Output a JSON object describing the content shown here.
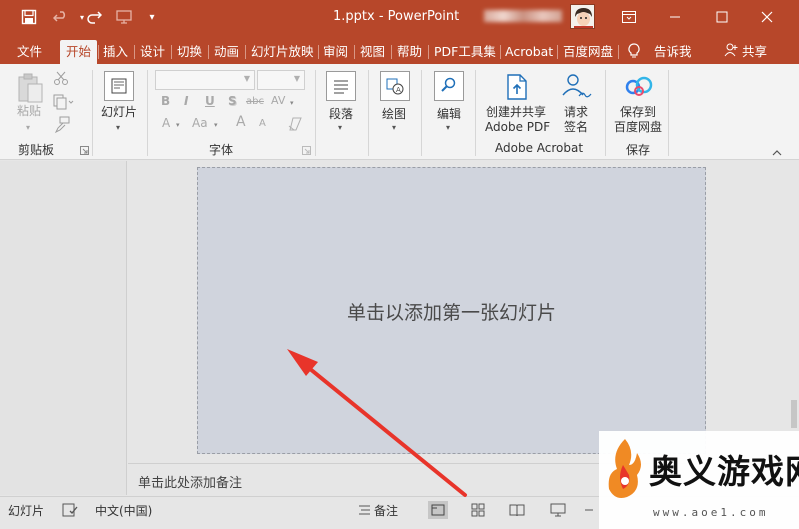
{
  "titlebar": {
    "title": "1.pptx  -  PowerPoint",
    "icons": [
      "save-icon",
      "undo-icon",
      "redo-icon",
      "start-from-beginning-icon",
      "customize-qat-icon"
    ],
    "window_buttons": [
      "ribbon-display-options-icon",
      "minimize-icon",
      "maximize-icon",
      "close-icon"
    ],
    "bg_color": "#b7472a"
  },
  "tabs": {
    "items": [
      "文件",
      "开始",
      "插入",
      "设计",
      "切换",
      "动画",
      "幻灯片放映",
      "审阅",
      "视图",
      "帮助",
      "PDF工具集",
      "Acrobat",
      "百度网盘"
    ],
    "active": "开始",
    "tell_me": "告诉我",
    "share": "共享"
  },
  "ribbon": {
    "clipboard": {
      "paste": "粘贴",
      "label": "剪贴板"
    },
    "slides": {
      "slide": "幻灯片"
    },
    "font": {
      "label": "字体",
      "bold": "B",
      "italic": "I",
      "underline": "U",
      "shadow": "S",
      "strike": "abc",
      "spacing": "AV",
      "font_color": "A",
      "case": "Aa",
      "grow": "A",
      "shrink": "A"
    },
    "paragraph": {
      "label": "段落"
    },
    "drawing": {
      "label": "绘图"
    },
    "editing": {
      "label": "编辑"
    },
    "acrobat": {
      "create_line1": "创建并共享",
      "create_line2": "Adobe PDF",
      "request_line1": "请求",
      "request_line2": "签名",
      "label": "Adobe Acrobat"
    },
    "save": {
      "line1": "保存到",
      "line2": "百度网盘",
      "label": "保存"
    }
  },
  "slide": {
    "placeholder": "单击以添加第一张幻灯片"
  },
  "notes": {
    "placeholder": "单击此处添加备注"
  },
  "statusbar": {
    "slide_label": "幻灯片",
    "language": "中文(中国)",
    "notes": "备注"
  },
  "watermark": {
    "title": "奥义游戏网",
    "url": "www.aoe1.com"
  }
}
